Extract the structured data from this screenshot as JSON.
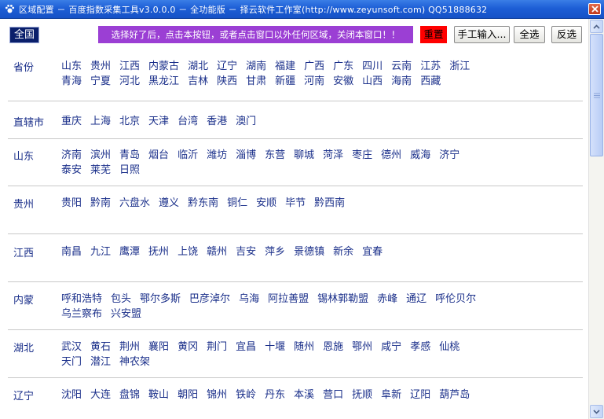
{
  "window": {
    "title": "区域配置 － 百度指数采集工具v3.0.0.0 － 全功能版 － 择云软件工作室(http://www.zeyunsoft.com) QQ51888632",
    "accent_color": "#1d5ed6",
    "icons": {
      "app": "paw-icon",
      "close": "close-icon"
    }
  },
  "toolbar": {
    "all_country_label": "全国",
    "notice_label": "选择好了后，点击本按钮，或者点击窗口以外任何区域，关闭本窗口！！",
    "reset_label": "重置",
    "manual_input_label": "手工输入...",
    "select_all_label": "全选",
    "invert_label": "反选",
    "colors": {
      "notice": "#9b3fd4",
      "reset": "#ff0000"
    }
  },
  "groups": [
    {
      "label": "省份",
      "rows": [
        [
          "山东",
          "贵州",
          "江西",
          "内蒙古",
          "湖北",
          "辽宁",
          "湖南",
          "福建",
          "广西",
          "广东",
          "四川",
          "云南",
          "江苏",
          "浙江"
        ],
        [
          "青海",
          "宁夏",
          "河北",
          "黑龙江",
          "吉林",
          "陕西",
          "甘肃",
          "新疆",
          "河南",
          "安徽",
          "山西",
          "海南",
          "西藏"
        ]
      ]
    },
    {
      "label": "直辖市",
      "rows": [
        [
          "重庆",
          "上海",
          "北京",
          "天津",
          "台湾",
          "香港",
          "澳门"
        ]
      ]
    },
    {
      "label": "山东",
      "rows": [
        [
          "济南",
          "滨州",
          "青岛",
          "烟台",
          "临沂",
          "潍坊",
          "淄博",
          "东营",
          "聊城",
          "菏泽",
          "枣庄",
          "德州",
          "威海",
          "济宁"
        ],
        [
          "泰安",
          "莱芜",
          "日照"
        ]
      ]
    },
    {
      "label": "贵州",
      "rows": [
        [
          "贵阳",
          "黔南",
          "六盘水",
          "遵义",
          "黔东南",
          "铜仁",
          "安顺",
          "毕节",
          "黔西南"
        ]
      ]
    },
    {
      "label": "江西",
      "rows": [
        [
          "南昌",
          "九江",
          "鹰潭",
          "抚州",
          "上饶",
          "赣州",
          "吉安",
          "萍乡",
          "景德镇",
          "新余",
          "宜春"
        ]
      ]
    },
    {
      "label": "内蒙",
      "rows": [
        [
          "呼和浩特",
          "包头",
          "鄂尔多斯",
          "巴彦淖尔",
          "乌海",
          "阿拉善盟",
          "锡林郭勒盟",
          "赤峰",
          "通辽",
          "呼伦贝尔"
        ],
        [
          "乌兰察布",
          "兴安盟"
        ]
      ]
    },
    {
      "label": "湖北",
      "rows": [
        [
          "武汉",
          "黄石",
          "荆州",
          "襄阳",
          "黄冈",
          "荆门",
          "宜昌",
          "十堰",
          "随州",
          "恩施",
          "鄂州",
          "咸宁",
          "孝感",
          "仙桃"
        ],
        [
          "天门",
          "潜江",
          "神农架"
        ]
      ]
    },
    {
      "label": "辽宁",
      "rows": [
        [
          "沈阳",
          "大连",
          "盘锦",
          "鞍山",
          "朝阳",
          "锦州",
          "铁岭",
          "丹东",
          "本溪",
          "营口",
          "抚顺",
          "阜新",
          "辽阳",
          "葫芦岛"
        ]
      ]
    }
  ],
  "scrollbar": {
    "icons": {
      "up": "arrow-up-icon",
      "down": "arrow-down-icon",
      "grip": "grip-icon"
    }
  }
}
